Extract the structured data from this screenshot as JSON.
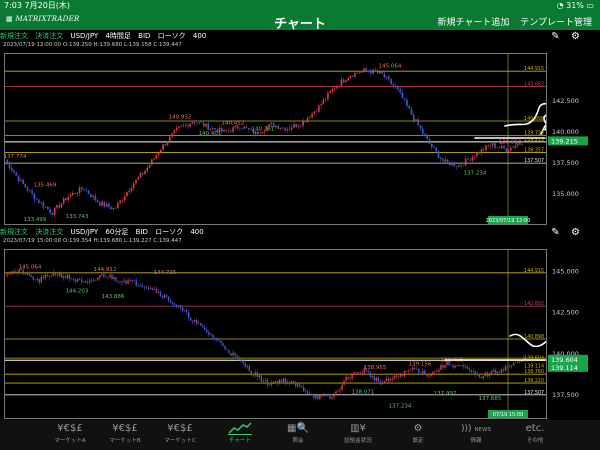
{
  "status": {
    "time": "7:03",
    "date": "7月20日(木)",
    "battery": "31%"
  },
  "app": {
    "logo": "MATRIXTRADER",
    "title": "チャート",
    "action_add": "新規チャート追加",
    "action_template": "テンプレート管理"
  },
  "charts": [
    {
      "new_order": "新規注文",
      "settle_order": "決済注文",
      "pair": "USD/JPY",
      "timeframe": "4時間足",
      "side": "BID",
      "chart_kind": "ローソク",
      "count": "400",
      "ohlc": "2023/07/19 12:00:00   O:139.250  H:139.680  L:139.158  C:139.447",
      "date_label": "2023/07/19 12:00",
      "axis_ticks": [
        "142.500",
        "140.000",
        "137.500",
        "135.000"
      ],
      "level_labels": [
        "144.915",
        "143.682",
        "140.898",
        "139.735",
        "139.215",
        "138.357",
        "137.507"
      ],
      "price_badge": "139.215",
      "annotations": [
        "137.774",
        "133.499",
        "135.469",
        "133.743",
        "140.932",
        "140.401",
        "140.452",
        "140.761",
        "145.064",
        "138.993",
        "137.234"
      ]
    },
    {
      "new_order": "新規注文",
      "settle_order": "決済注文",
      "pair": "USD/JPY",
      "timeframe": "60分足",
      "side": "BID",
      "chart_kind": "ローソク",
      "count": "400",
      "ohlc": "2023/07/19 15:00:00   O:139.354  H:139.680  L:139.227  C:139.447",
      "date_label": "07/19 15:00",
      "axis_ticks": [
        "145.000",
        "142.500",
        "140.000",
        "137.500"
      ],
      "level_labels": [
        "144.915",
        "142.892",
        "140.898",
        "139.604",
        "139.114",
        "138.760",
        "138.220",
        "137.507"
      ],
      "price_badge": "139.604",
      "price_badge2": "139.114",
      "annotations": [
        "145.064",
        "144.203",
        "144.912",
        "143.886",
        "144.735",
        "138.955",
        "138.071",
        "137.234",
        "139.156",
        "137.997",
        "139.405",
        "137.685"
      ]
    }
  ],
  "tabs": [
    {
      "icon": "¥€$£",
      "label": "マーケットA"
    },
    {
      "icon": "¥€$£",
      "label": "マーケットB"
    },
    {
      "icon": "¥€$£",
      "label": "マーケットC"
    },
    {
      "icon": "chart",
      "label": "チャート"
    },
    {
      "icon": "search",
      "label": "照会"
    },
    {
      "icon": "account",
      "label": "証拠金状況"
    },
    {
      "icon": "gear",
      "label": "設定"
    },
    {
      "icon": "news",
      "label": "情報"
    },
    {
      "icon": "etc",
      "label": "その他"
    }
  ],
  "tab_icon_text": {
    "etc": "etc.",
    "news": "NEWS"
  },
  "colors": {
    "green": "#0a7a33",
    "up": "#e03c3c",
    "down": "#3f5bd6",
    "level_yellow": "#c8b400",
    "level_red": "#d43a6b",
    "level_white": "#e6e6e6",
    "badge_green": "#1aa34a"
  }
}
